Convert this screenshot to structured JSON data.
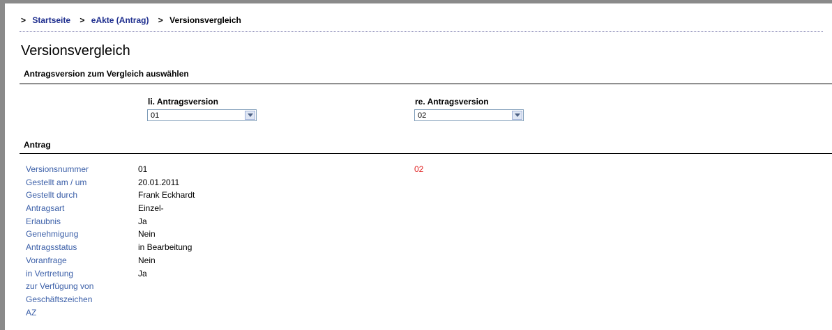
{
  "breadcrumb": {
    "sep1": ">",
    "home": "Startseite",
    "sep2": ">",
    "parent": "eAkte (Antrag)",
    "sep3": ">",
    "current": "Versionsvergleich"
  },
  "page_title": "Versionsvergleich",
  "select_section": {
    "title": "Antragsversion zum Vergleich auswählen",
    "left_label": "li. Antragsversion",
    "left_value": "01",
    "right_label": "re. Antragsversion",
    "right_value": "02"
  },
  "antrag": {
    "title": "Antrag",
    "rows": [
      {
        "label": "Versionsnummer",
        "left": "01",
        "right": "02"
      },
      {
        "label": "Gestellt am / um",
        "left": "20.01.2011",
        "right": ""
      },
      {
        "label": "Gestellt durch",
        "left": "Frank Eckhardt",
        "right": ""
      },
      {
        "label": "Antragsart",
        "left": "Einzel-",
        "right": ""
      },
      {
        "label": "Erlaubnis",
        "left": "Ja",
        "right": ""
      },
      {
        "label": "Genehmigung",
        "left": "Nein",
        "right": ""
      },
      {
        "label": "Antragsstatus",
        "left": "in Bearbeitung",
        "right": ""
      },
      {
        "label": "Voranfrage",
        "left": "Nein",
        "right": ""
      },
      {
        "label": "in Vertretung",
        "left": "Ja",
        "right": ""
      },
      {
        "label": "zur Verfügung von",
        "left": "",
        "right": ""
      },
      {
        "label": "Geschäftszeichen",
        "left": "",
        "right": ""
      },
      {
        "label": "AZ",
        "left": "",
        "right": ""
      }
    ]
  },
  "colors": {
    "label_blue": "#3b5fa8",
    "link_blue": "#1f2f8f",
    "diff_red": "#e02020"
  }
}
